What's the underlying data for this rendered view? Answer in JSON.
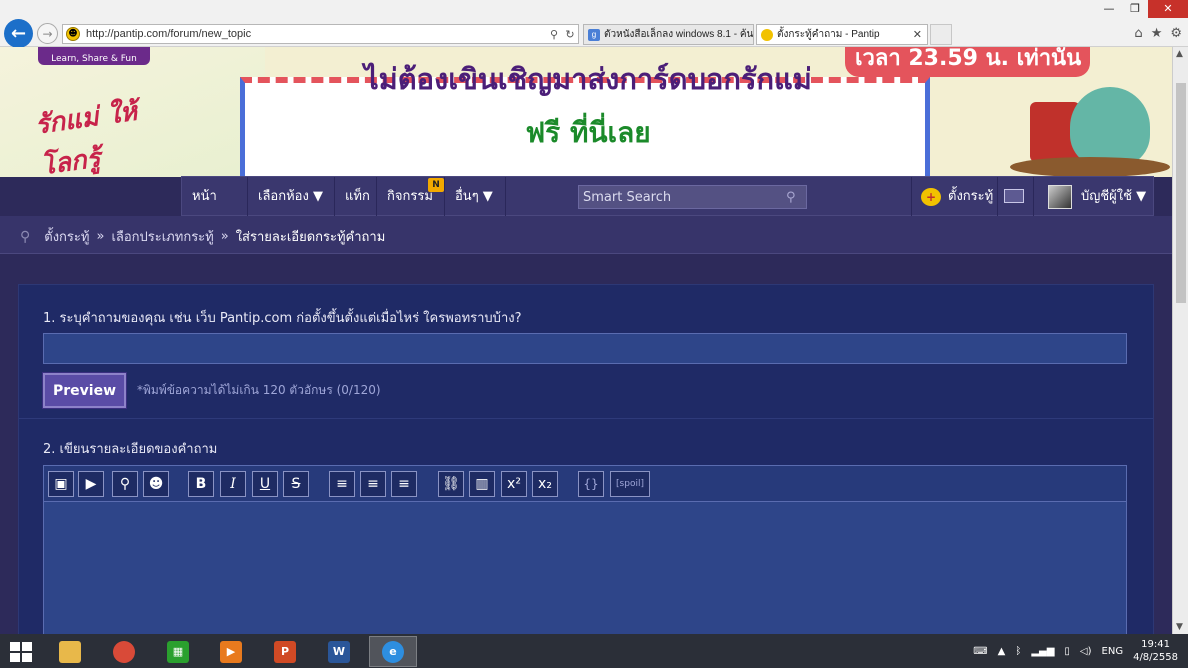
{
  "browser": {
    "url": "http://pantip.com/forum/new_topic",
    "tabs": [
      {
        "label": "ตัวหนังสือเล็กลง windows 8.1 - ค้น..."
      },
      {
        "label": "ตั้งกระทู้คำถาม - Pantip"
      }
    ]
  },
  "banner": {
    "logo_tagline": "Learn, Share & Fun",
    "love_mom": "รักแม่ ให้โลกรู้",
    "headline": "ไม่ต้องเขินเชิญมาส่งการ์ดบอกรักแม่",
    "subline": "ฟรี ที่นี่เลย",
    "time_badge": "เวลา 23.59 น. เท่านั้น"
  },
  "nav": {
    "home": "หน้าแรก",
    "room": "เลือกห้อง ▼",
    "tag": "แท็ก",
    "activity": "กิจกรรม",
    "activity_badge": "N",
    "other": "อื่นๆ ▼",
    "search_placeholder": "Smart Search",
    "post": "ตั้งกระทู้",
    "user": "บัญชีผู้ใช้ ▼"
  },
  "breadcrumb": {
    "items": [
      "ตั้งกระทู้",
      "เลือกประเภทกระทู้",
      "ใส่รายละเอียดกระทู้คำถาม"
    ],
    "separator": "»"
  },
  "form": {
    "q1_label": "1. ระบุคำถามของคุณ เช่น เว็บ Pantip.com ก่อตั้งขึ้นตั้งแต่เมื่อไหร่ ใครพอทราบบ้าง?",
    "title_value": "",
    "preview_label": "Preview",
    "char_hint": "*พิมพ์ข้อความได้ไม่เกิน 120 ตัวอักษร (0/120)",
    "q2_label": "2. เขียนรายละเอียดของคำถาม",
    "toolbar": {
      "bold": "B",
      "italic": "I",
      "underline": "U",
      "strike": "S",
      "code": "{}",
      "spoil": "[spoil]"
    }
  },
  "taskbar": {
    "lang": "ENG",
    "time": "19:41",
    "date": "4/8/2558"
  },
  "colors": {
    "page_bg": "#2d2a5a",
    "panel_bg": "#1f2a66",
    "input_bg": "#2e4589",
    "nav_bg": "#3a376e",
    "accent_badge": "#f2a900"
  }
}
